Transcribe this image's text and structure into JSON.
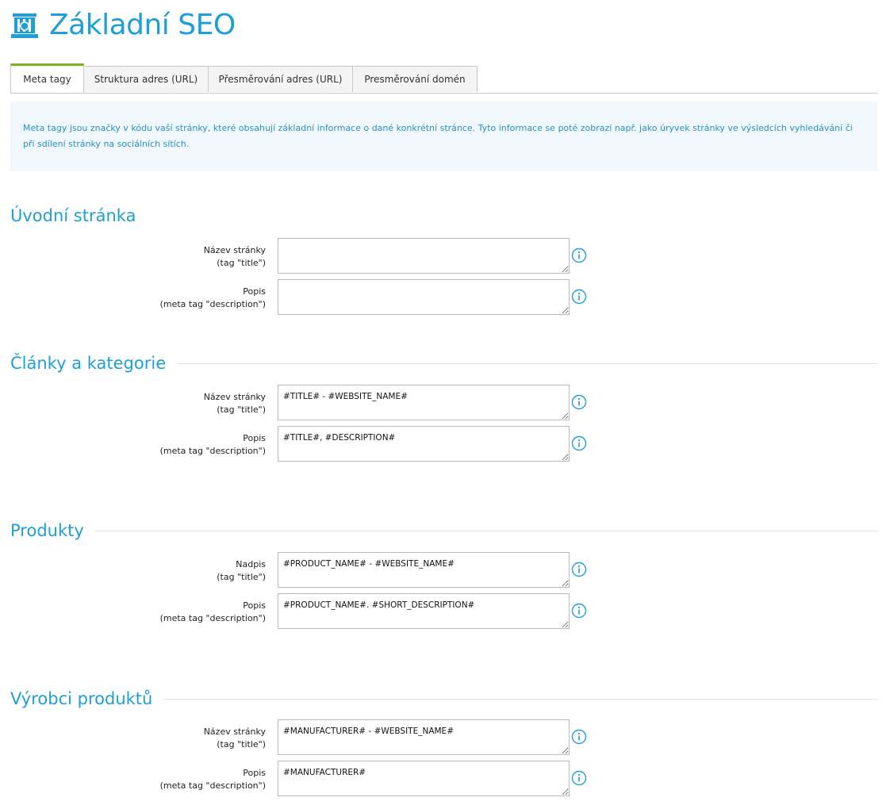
{
  "header": {
    "title": "Základní SEO",
    "icon": "seo-books-icon",
    "accent_color": "#1ea0d6"
  },
  "tabs": [
    {
      "label": "Meta tagy",
      "active": true
    },
    {
      "label": "Struktura adres (URL)",
      "active": false
    },
    {
      "label": "Přesměrování adres (URL)",
      "active": false
    },
    {
      "label": "Presměrování domén",
      "active": false
    }
  ],
  "info": {
    "text": "Meta tagy jsou značky v kódu vaší stránky, které obsahují základní informace o dané konkrétní stránce. Tyto informace se poté zobrazí např. jako úryvek stránky ve výsledcích vyhledávání či při sdílení stránky na sociálních sítích."
  },
  "sections": [
    {
      "title": "Úvodní stránka",
      "fields": [
        {
          "label_line1": "Název stránky",
          "label_line2": "(tag \"title\")",
          "value": ""
        },
        {
          "label_line1": "Popis",
          "label_line2": "(meta tag \"description\")",
          "value": ""
        }
      ]
    },
    {
      "title": "Články a kategorie",
      "fields": [
        {
          "label_line1": "Název stránky",
          "label_line2": "(tag \"title\")",
          "value": "#TITLE# - #WEBSITE_NAME#"
        },
        {
          "label_line1": "Popis",
          "label_line2": "(meta tag \"description\")",
          "value": "#TITLE#, #DESCRIPTION#"
        }
      ]
    },
    {
      "title": "Produkty",
      "fields": [
        {
          "label_line1": "Nadpis",
          "label_line2": "(tag \"title\")",
          "value": "#PRODUCT_NAME# - #WEBSITE_NAME#"
        },
        {
          "label_line1": "Popis",
          "label_line2": "(meta tag \"description\")",
          "value": "#PRODUCT_NAME#. #SHORT_DESCRIPTION#"
        }
      ]
    },
    {
      "title": "Výrobci produktů",
      "fields": [
        {
          "label_line1": "Název stránky",
          "label_line2": "(tag \"title\")",
          "value": "#MANUFACTURER# - #WEBSITE_NAME#"
        },
        {
          "label_line1": "Popis",
          "label_line2": "(meta tag \"description\")",
          "value": "#MANUFACTURER#"
        }
      ]
    }
  ]
}
